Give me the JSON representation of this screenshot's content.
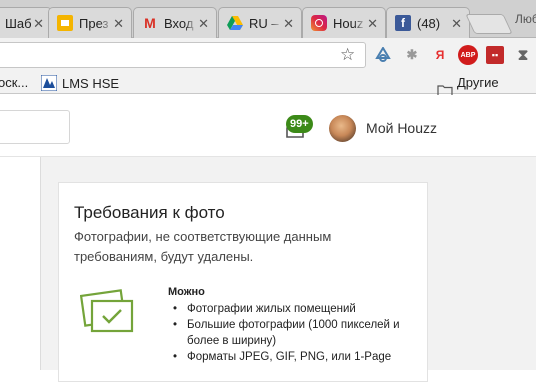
{
  "tabs": [
    {
      "title": "Шаб",
      "icon": "partial-tab-icon"
    },
    {
      "title": "През",
      "icon": "slides-icon",
      "color": "#f4b400"
    },
    {
      "title": "Вход",
      "icon": "gmail-icon",
      "color": "#d93025"
    },
    {
      "title": "RU –",
      "icon": "drive-icon"
    },
    {
      "title": "Houz",
      "icon": "instagram-icon"
    },
    {
      "title": "(48)",
      "icon": "facebook-icon",
      "color": "#3b5998"
    }
  ],
  "window_label": "Люб",
  "extensions": {
    "yandex_label": "Я",
    "abp_label": "ABP"
  },
  "bookmarks": {
    "partial_item": "оск...",
    "lms": "LMS HSE",
    "other": "Другие закла"
  },
  "header": {
    "notifications_badge": "99+",
    "profile_label": "Мой Houzz"
  },
  "photo_requirements": {
    "title": "Требования к фото",
    "subtitle": "Фотографии, не соответствующие данным требованиям, будут удалены.",
    "allowed_title": "Можно",
    "allowed_items": [
      "Фотографии жилых помещений",
      "Большие фотографии (1000 пикселей и более в ширину)",
      "Форматы JPEG, GIF, PNG, или 1-Page"
    ]
  },
  "colors": {
    "accent_green": "#3c8a18",
    "icon_green": "#74a43a"
  }
}
